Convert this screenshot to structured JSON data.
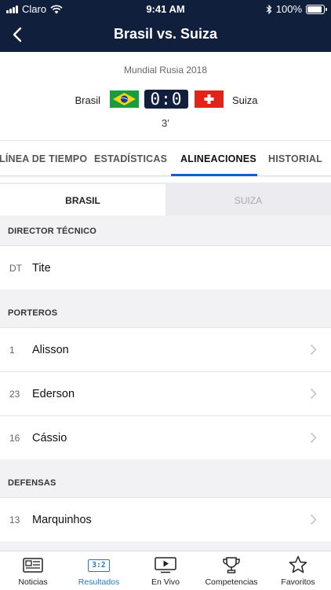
{
  "status_bar": {
    "carrier": "Claro",
    "time": "9:41 AM",
    "battery": "100%",
    "battery_level": 1.0
  },
  "nav": {
    "title": "Brasil vs. Suiza",
    "back_icon": "chevron-left-icon"
  },
  "match": {
    "competition": "Mundial Rusia 2018",
    "home_team": "Brasil",
    "away_team": "Suiza",
    "score": "0:0",
    "minute": "3’"
  },
  "tabs": [
    {
      "label": "LÍNEA DE TIEMPO"
    },
    {
      "label": "ESTADÍSTICAS"
    },
    {
      "label": "ALINEACIONES",
      "active": true
    },
    {
      "label": "HISTORIAL"
    }
  ],
  "team_segment": {
    "home": "BRASIL",
    "away": "SUIZA",
    "selected": "BRASIL"
  },
  "sections": [
    {
      "title": "DIRECTOR TÉCNICO",
      "rows": [
        {
          "number": "DT",
          "name": "Tite",
          "chevron": false
        }
      ]
    },
    {
      "title": "PORTEROS",
      "rows": [
        {
          "number": "1",
          "name": "Alisson",
          "chevron": true
        },
        {
          "number": "23",
          "name": "Ederson",
          "chevron": true
        },
        {
          "number": "16",
          "name": "Cássio",
          "chevron": true
        }
      ]
    },
    {
      "title": "DEFENSAS",
      "rows": [
        {
          "number": "13",
          "name": "Marquinhos",
          "chevron": true
        }
      ]
    }
  ],
  "tab_bar": [
    {
      "label": "Noticias",
      "icon": "newspaper-icon"
    },
    {
      "label": "Resultados",
      "icon": "scoreboard-icon",
      "icon_text": "3:2",
      "active": true
    },
    {
      "label": "En Vivo",
      "icon": "tv-play-icon"
    },
    {
      "label": "Competencias",
      "icon": "trophy-icon"
    },
    {
      "label": "Favoritos",
      "icon": "star-icon"
    }
  ],
  "colors": {
    "navy": "#0f1f3c",
    "accent_blue": "#1f7ac9",
    "tab_underline": "#0f5fd6",
    "brazil_green": "#1a9c3e",
    "swiss_red": "#e2231a"
  }
}
